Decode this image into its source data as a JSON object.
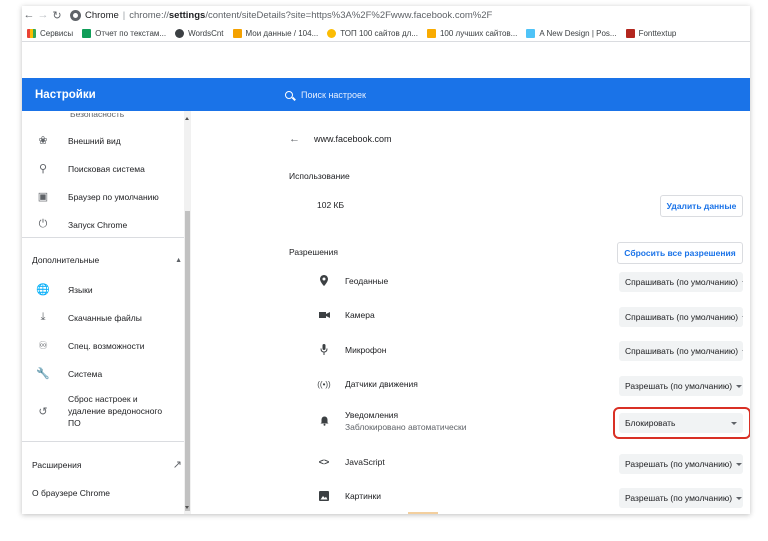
{
  "browser": {
    "tab_title": "Chrome",
    "url_prefix": "chrome://",
    "url_host": "settings",
    "url_rest": "/content/siteDetails?site=https%3A%2F%2Fwww.facebook.com%2F",
    "bookmarks": [
      {
        "label": "Сервисы",
        "color": "#ea4335",
        "icon": "apps-grid-icon"
      },
      {
        "label": "Отчет по текстам...",
        "color": "#0f9d58",
        "icon": "plus-green-icon"
      },
      {
        "label": "WordsCnt",
        "color": "#3c4043",
        "icon": "wordscnt-icon"
      },
      {
        "label": "Мои данные / 104...",
        "color": "#f4a100",
        "icon": "folder-orange-icon"
      },
      {
        "label": "ТОП 100 сайтов дл...",
        "color": "#fbbc04",
        "icon": "lightbulb-icon"
      },
      {
        "label": "100 лучших сайтов...",
        "color": "#f9ab00",
        "icon": "c-yellow-icon"
      },
      {
        "label": "A New Design | Pos...",
        "color": "#4fc3f7",
        "icon": "design-icon"
      },
      {
        "label": "Fonttextup",
        "color": "#b3261e",
        "icon": "fonttextup-icon"
      }
    ]
  },
  "header": {
    "title": "Настройки",
    "search_placeholder": "Поиск настроек"
  },
  "sidebar": {
    "cut_label": "Безопасность",
    "items": [
      {
        "label": "Внешний вид",
        "icon": "palette-icon"
      },
      {
        "label": "Поисковая система",
        "icon": "search-icon"
      },
      {
        "label": "Браузер по умолчанию",
        "icon": "browser-icon"
      },
      {
        "label": "Запуск Chrome",
        "icon": "power-icon"
      }
    ],
    "advanced_label": "Дополнительные",
    "advanced_items": [
      {
        "label": "Языки",
        "icon": "globe-icon"
      },
      {
        "label": "Скачанные файлы",
        "icon": "download-icon"
      },
      {
        "label": "Спец. возможности",
        "icon": "accessibility-icon"
      },
      {
        "label": "Система",
        "icon": "wrench-icon"
      },
      {
        "label_lines": [
          "Сброс настроек и",
          "удаление вредоносного",
          "ПО"
        ],
        "icon": "restore-icon"
      }
    ],
    "extensions_label": "Расширения",
    "about_label": "О браузере Chrome"
  },
  "main": {
    "site": "www.facebook.com",
    "usage_title": "Использование",
    "usage_value": "102 КБ",
    "clear_data_button": "Удалить данные",
    "permissions_title": "Разрешения",
    "reset_permissions_button": "Сбросить все разрешения",
    "permissions": [
      {
        "label": "Геоданные",
        "icon": "location-pin-icon",
        "value": "Спрашивать (по умолчанию)"
      },
      {
        "label": "Камера",
        "icon": "camera-icon",
        "value": "Спрашивать (по умолчанию)"
      },
      {
        "label": "Микрофон",
        "icon": "microphone-icon",
        "value": "Спрашивать (по умолчанию)"
      },
      {
        "label": "Датчики движения",
        "icon": "motion-sensor-icon",
        "value": "Разрешать (по умолчанию)"
      },
      {
        "label": "Уведомления",
        "sublabel": "Заблокировано автоматически",
        "icon": "bell-icon",
        "value": "Блокировать"
      },
      {
        "label": "JavaScript",
        "icon": "code-icon",
        "value": "Разрешать (по умолчанию)"
      },
      {
        "label": "Картинки",
        "icon": "image-icon",
        "value": "Разрешать (по умолчанию)"
      }
    ]
  },
  "colors": {
    "accent": "#1a73e8",
    "highlight": "#d93025"
  }
}
